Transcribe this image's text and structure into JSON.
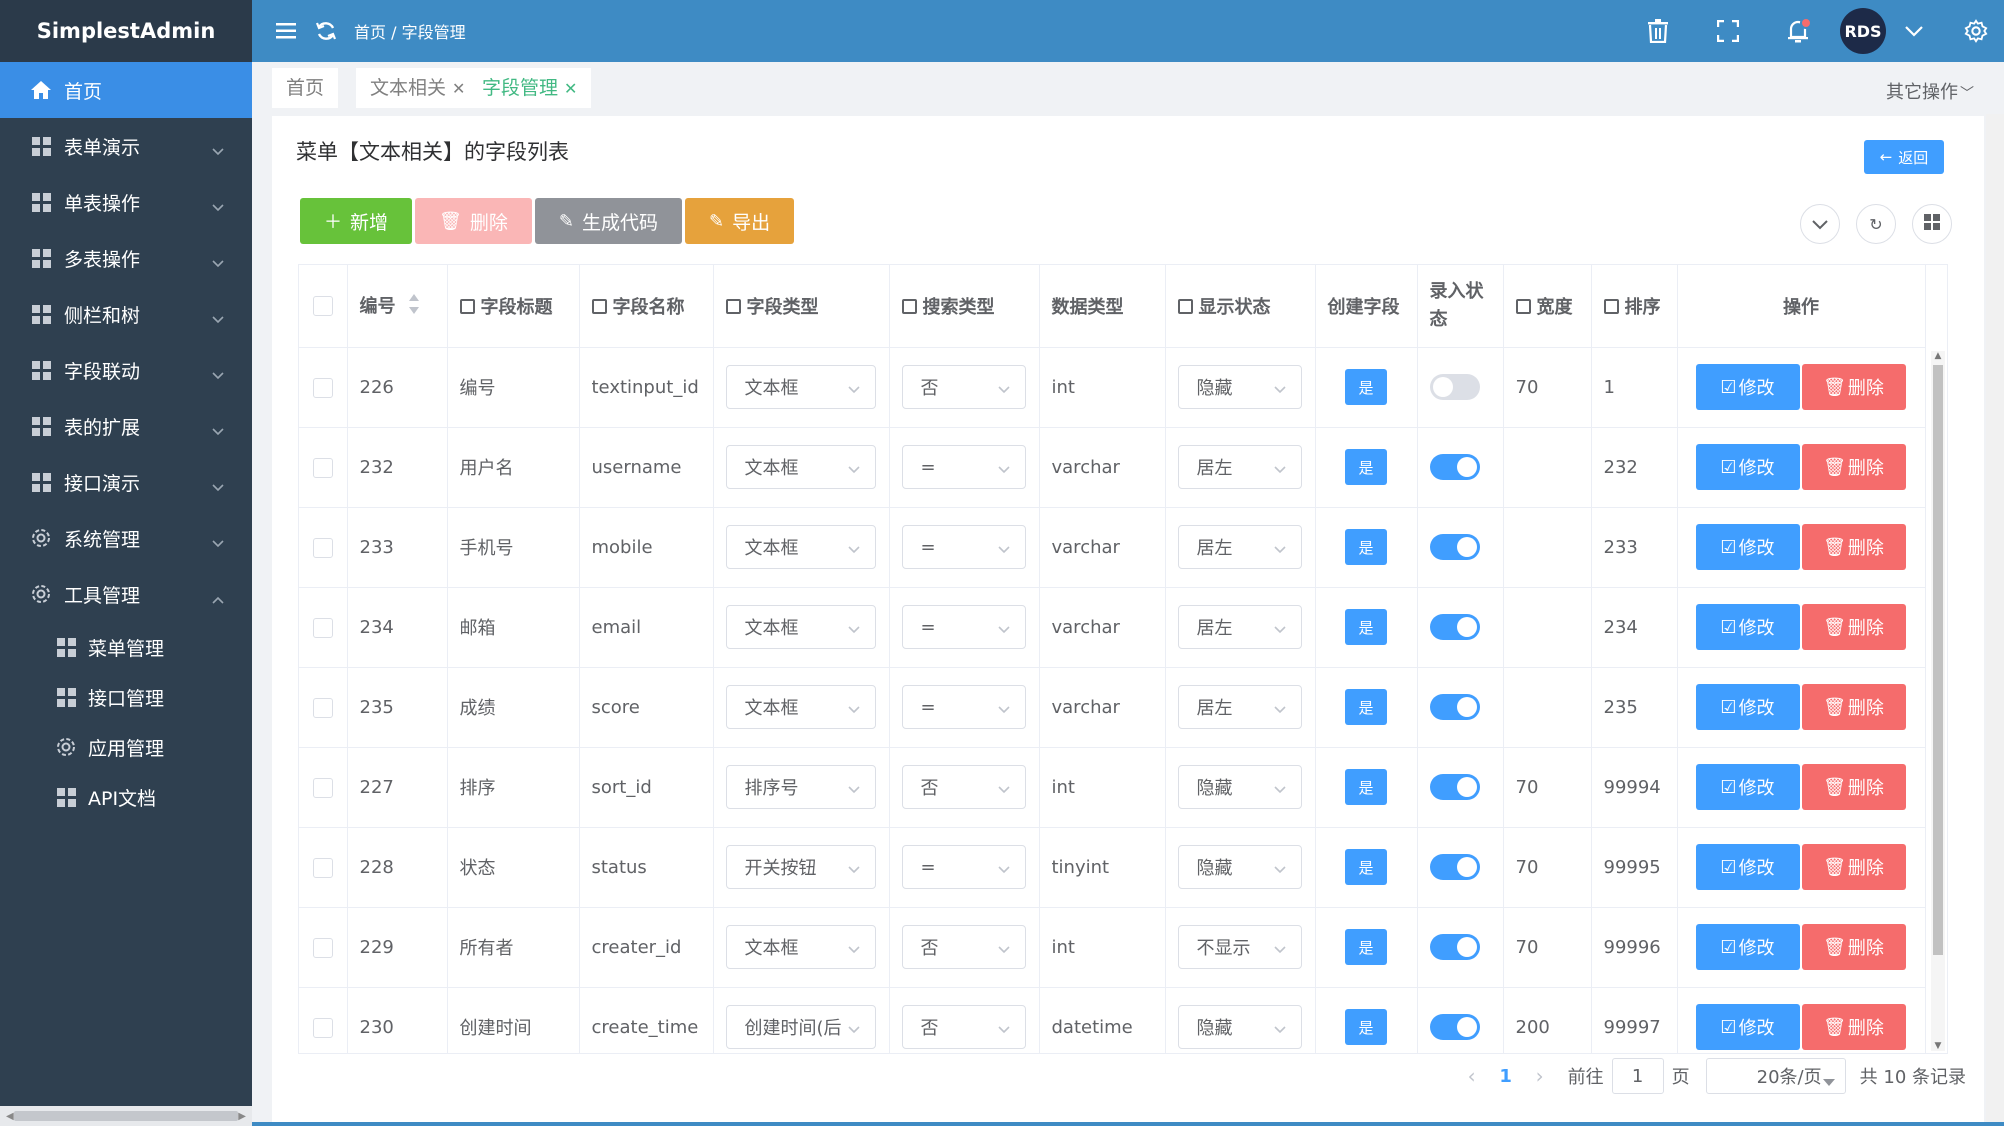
{
  "app": {
    "title": "SimplestAdmin"
  },
  "sidebar": {
    "items": [
      {
        "label": "首页",
        "icon": "home-icon",
        "active": true
      },
      {
        "label": "表单演示",
        "icon": "grid-icon"
      },
      {
        "label": "单表操作",
        "icon": "grid-icon"
      },
      {
        "label": "多表操作",
        "icon": "grid-icon"
      },
      {
        "label": "侧栏和树",
        "icon": "grid-icon"
      },
      {
        "label": "字段联动",
        "icon": "grid-icon"
      },
      {
        "label": "表的扩展",
        "icon": "grid-icon"
      },
      {
        "label": "接口演示",
        "icon": "grid-icon"
      },
      {
        "label": "系统管理",
        "icon": "gear-icon"
      },
      {
        "label": "工具管理",
        "icon": "gear-icon",
        "expanded": true
      }
    ],
    "subitems": [
      {
        "label": "菜单管理",
        "icon": "grid-icon"
      },
      {
        "label": "接口管理",
        "icon": "grid-icon"
      },
      {
        "label": "应用管理",
        "icon": "gear-icon"
      },
      {
        "label": "API文档",
        "icon": "grid-icon"
      }
    ]
  },
  "header": {
    "breadcrumb": "首页 / 字段管理",
    "avatar_text": "RDS",
    "colors": {
      "header_bg": "#3e8bc4",
      "sidebar_bg": "#2f4050",
      "active": "#3a8ee6"
    }
  },
  "tabs": [
    {
      "label": "首页",
      "closable": false,
      "active": false
    },
    {
      "label": "文本相关",
      "closable": true,
      "active": false
    },
    {
      "label": "字段管理",
      "closable": true,
      "active": true
    }
  ],
  "tabs_other": "其它操作",
  "page": {
    "title": "菜单【文本相关】的字段列表",
    "back_label": "返回"
  },
  "toolbar": {
    "add_label": "新增",
    "delete_label": "删除",
    "gen_label": "生成代码",
    "export_label": "导出"
  },
  "table": {
    "headers": {
      "id": "编号",
      "title": "字段标题",
      "name": "字段名称",
      "type": "字段类型",
      "search": "搜索类型",
      "dtype": "数据类型",
      "display": "显示状态",
      "create": "创建字段",
      "entry": "录入状态",
      "width": "宽度",
      "sort": "排序",
      "ops": "操作"
    },
    "edit_label": "修改",
    "delete_label": "删除",
    "yes_label": "是",
    "rows": [
      {
        "id": "226",
        "title": "编号",
        "name": "textinput_id",
        "type": "文本框",
        "search": "否",
        "dtype": "int",
        "display": "隐藏",
        "entry": false,
        "width": "70",
        "sort": "1"
      },
      {
        "id": "232",
        "title": "用户名",
        "name": "username",
        "type": "文本框",
        "search": "=",
        "dtype": "varchar",
        "display": "居左",
        "entry": true,
        "width": "",
        "sort": "232"
      },
      {
        "id": "233",
        "title": "手机号",
        "name": "mobile",
        "type": "文本框",
        "search": "=",
        "dtype": "varchar",
        "display": "居左",
        "entry": true,
        "width": "",
        "sort": "233"
      },
      {
        "id": "234",
        "title": "邮箱",
        "name": "email",
        "type": "文本框",
        "search": "=",
        "dtype": "varchar",
        "display": "居左",
        "entry": true,
        "width": "",
        "sort": "234"
      },
      {
        "id": "235",
        "title": "成绩",
        "name": "score",
        "type": "文本框",
        "search": "=",
        "dtype": "varchar",
        "display": "居左",
        "entry": true,
        "width": "",
        "sort": "235"
      },
      {
        "id": "227",
        "title": "排序",
        "name": "sort_id",
        "type": "排序号",
        "search": "否",
        "dtype": "int",
        "display": "隐藏",
        "entry": true,
        "width": "70",
        "sort": "99994"
      },
      {
        "id": "228",
        "title": "状态",
        "name": "status",
        "type": "开关按钮",
        "search": "=",
        "dtype": "tinyint",
        "display": "隐藏",
        "entry": true,
        "width": "70",
        "sort": "99995"
      },
      {
        "id": "229",
        "title": "所有者",
        "name": "creater_id",
        "type": "文本框",
        "search": "否",
        "dtype": "int",
        "display": "不显示",
        "entry": true,
        "width": "70",
        "sort": "99996"
      },
      {
        "id": "230",
        "title": "创建时间",
        "name": "create_time",
        "type": "创建时间(后",
        "search": "否",
        "dtype": "datetime",
        "display": "隐藏",
        "entry": true,
        "width": "200",
        "sort": "99997"
      }
    ]
  },
  "pager": {
    "current": "1",
    "goto_prefix": "前往",
    "goto_value": "1",
    "goto_suffix": "页",
    "page_size": "20条/页",
    "total": "共 10 条记录"
  }
}
